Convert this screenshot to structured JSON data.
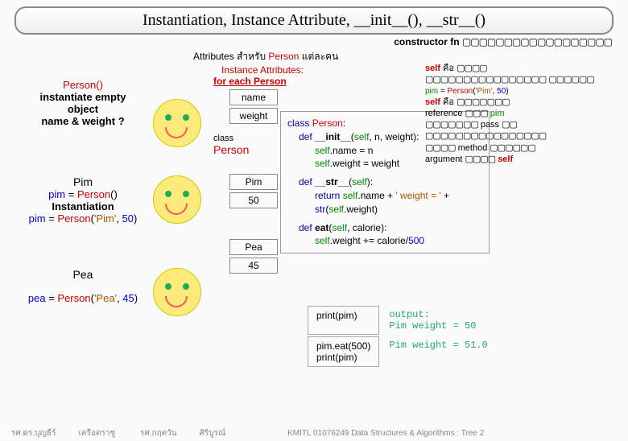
{
  "title": "Instantiation, Instance Attribute, __init__(), __str__()",
  "constructor_label": "constructor fn",
  "constructor_boxes": "▢▢▢▢▢▢▢▢▢▢▢▢▢▢▢▢▢▢",
  "attrs_label": "Attributes สำหรับ",
  "attrs_person": "Person",
  "attrs_suffix": "แต่ละคน",
  "left1": {
    "call": "Person()",
    "l1": "instantiate empty",
    "l2": "object",
    "l3": "name & weight ?"
  },
  "left2": {
    "name": "Pim",
    "line1": "pim = Person()",
    "title": "Instantiation",
    "line2": "pim = Person('Pim', 50)"
  },
  "left3": {
    "name": "Pea",
    "line2": "pea = Person('Pea', 45)"
  },
  "col2": {
    "ia": "Instance Attributes:",
    "iab": "for each Person",
    "b_name": "name",
    "b_weight": "weight",
    "class_lbl": "class",
    "person_lbl": "Person",
    "pim": "Pim",
    "v50": "50",
    "pea": "Pea",
    "v45": "45"
  },
  "code": {
    "l1a": "class",
    "l1b": "Person",
    "l2a": "def",
    "l2b": "__init__",
    "l2c": "self",
    "l2d": "n",
    "l2e": "weight",
    "l3a": "self",
    "l3b": ".name = n",
    "l4a": "self",
    "l4b": ".weight = weight",
    "l5a": "def",
    "l5b": "__str__",
    "l5c": "self",
    "l6a": "return",
    "l6b": "self",
    "l6c": ".name + ",
    "l6d": "' weight = '",
    "l6e": " + ",
    "l6f": "str",
    "l6g": "self",
    "l6h": ".weight)",
    "l7a": "def",
    "l7b": "eat",
    "l7c": "self",
    "l7d": "calorie",
    "l8a": "self",
    "l8b": ".weight += calorie/",
    "l8c": "500"
  },
  "right": {
    "l1a": "self",
    "l1b": "คือ",
    "box1": "▢▢▢▢",
    "l2": "▢▢▢▢▢▢▢▢▢▢▢▢▢▢▢▢",
    "l3": "▢▢▢▢▢▢",
    "pim_line": "pim = Person('Pim', 50)",
    "r1a": "self",
    "r1b": "คือ",
    "r1c": "▢▢▢▢▢▢▢",
    "r2a": "reference",
    "r2b": "▢▢▢",
    "r2c": "pim",
    "r3": "▢▢▢▢▢▢▢ pass ▢▢",
    "r4": "▢▢▢▢▢▢▢▢▢▢▢▢▢▢▢▢",
    "r5a": "▢▢▢▢",
    "r5b": "method",
    "r5c": "▢▢▢▢▢▢",
    "r6a": "argument",
    "r6b": "▢▢▢▢",
    "r6c": "self"
  },
  "out": {
    "p1": "print(pim)",
    "o1a": "output:",
    "o1b": "Pim weight = 50",
    "p2a": "pim.eat(500)",
    "p2b": "print(pim)",
    "o2": "Pim weight = 51.0"
  },
  "footer": {
    "a": "รศ.ดร.บุญธีร์",
    "b": "เครือตราชู",
    "c": "รศ.กฤตวัน",
    "d": "ศิริบูรณ์",
    "e": "KMITL  01076249 Data Structures & Algorithms : Tree 2"
  }
}
